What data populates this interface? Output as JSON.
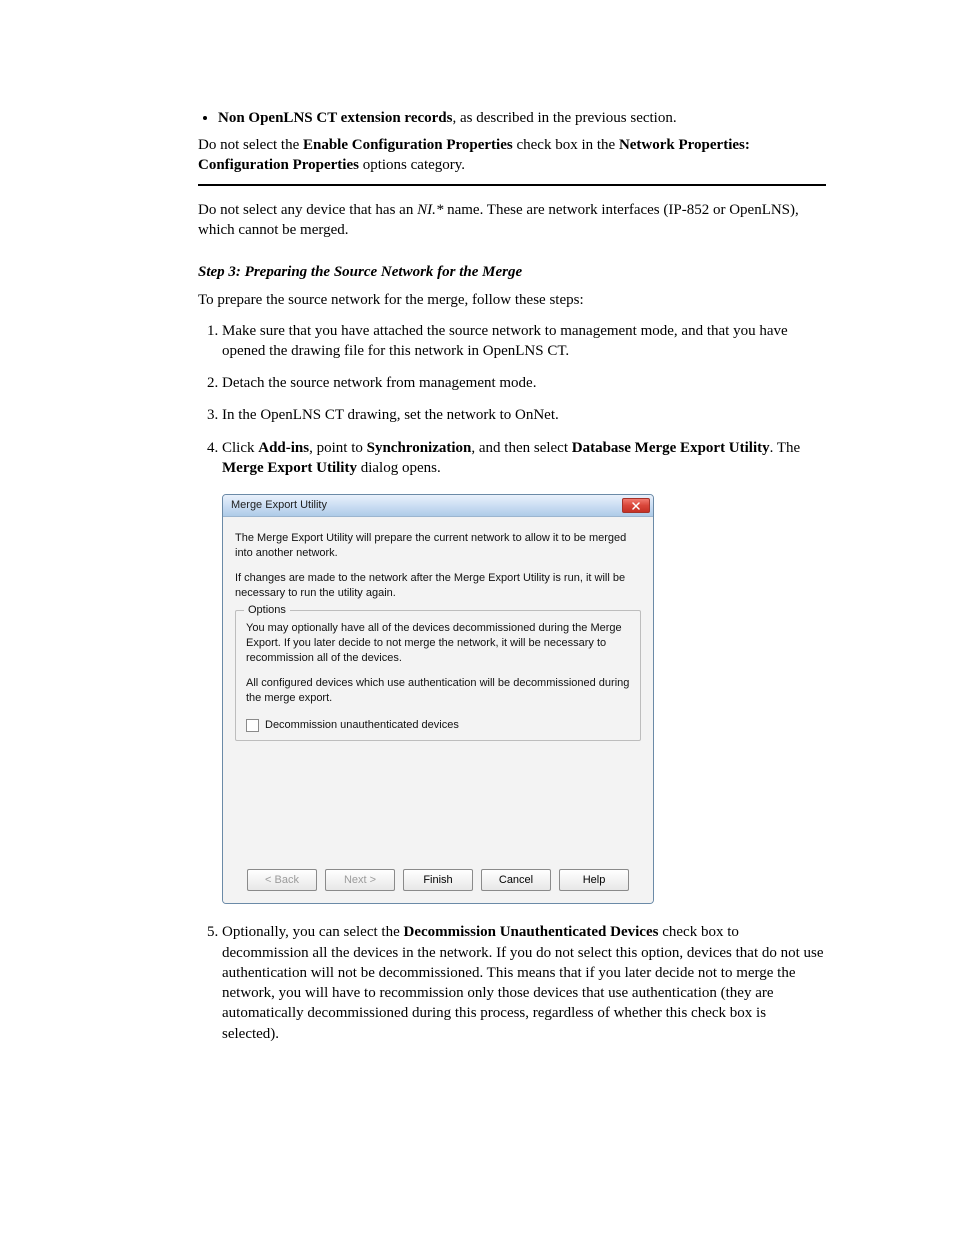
{
  "doc": {
    "bullet1": "Non OpenLNS CT extension records",
    "bullet1_tail": ", as described in the previous section.",
    "para_after_bullet_1": "Do not select the ",
    "para_after_bullet_bold1": "Enable Configuration Properties",
    "para_after_bullet_2": " check box in the ",
    "para_after_bullet_bold2": "Network Properties: Configuration Properties",
    "para_after_bullet_3": " options category.",
    "para_ni_pre": "Do not select any device that has an ",
    "para_ni_ital": "NI.*",
    "para_ni_post": " name. These are network interfaces (IP-852 or OpenLNS), which cannot be merged.",
    "step3_header": "Step 3: Preparing the Source Network for the Merge",
    "step3_intro": "To prepare the source network for the merge, follow these steps:",
    "step3_num1": "Make sure that you have attached the source network to management mode, and that you have opened the drawing file for this network in OpenLNS CT.",
    "step3_num2": "Detach the source network from management mode.",
    "step3_num3": "In the OpenLNS CT drawing, set the network to OnNet.",
    "step3_num4a": "Click ",
    "step3_num4_bold1": "Add-ins",
    "step3_num4b": ", point to ",
    "step3_num4_bold2": "Synchronization",
    "step3_num4c": ", and then select ",
    "step3_num4_bold3": "Database Merge Export Utility",
    "step3_num4d": ". The ",
    "step3_num4_bold4": "Merge Export Utility",
    "step3_num4e": " dialog opens.",
    "step3_num5a": "Optionally, you can select the ",
    "step3_num5_bold": "Decommission Unauthenticated Devices",
    "step3_num5b": " check box to decommission all the devices in the network. If you do not select this option, devices that do not use authentication will not be decommissioned. This means that if you later decide not to merge the network, you will have to recommission only those devices that use authentication (they are automatically decommissioned during this process, regardless of whether this check box is selected)."
  },
  "dialog": {
    "title": "Merge Export Utility",
    "p1": "The Merge Export Utility will prepare the current network to allow it to be merged into another network.",
    "p2": "If changes are made to the network after the Merge Export Utility is run, it will be necessary to run the utility again.",
    "group_label": "Options",
    "opt_p1": "You may optionally have all of the devices decommissioned during the Merge Export. If you later decide to not merge the network, it will be necessary to recommission all of the devices.",
    "opt_p2": "All configured devices which use authentication will be decommissioned during the merge export.",
    "checkbox_label": "Decommission unauthenticated devices",
    "buttons": {
      "back": "< Back",
      "next": "Next >",
      "finish": "Finish",
      "cancel": "Cancel",
      "help": "Help"
    }
  }
}
